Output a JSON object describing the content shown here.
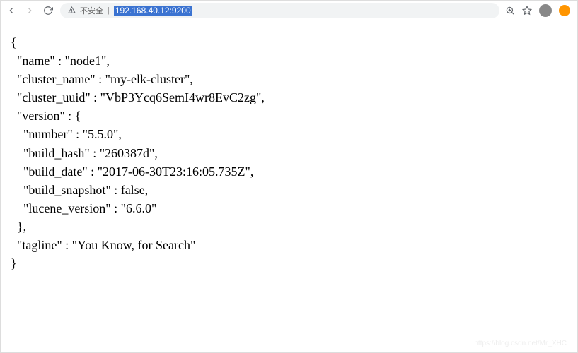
{
  "browser": {
    "insecure_label": "不安全",
    "url": "192.168.40.12:9200"
  },
  "json_response": {
    "name": "node1",
    "cluster_name": "my-elk-cluster",
    "cluster_uuid": "VbP3Ycq6SemI4wr8EvC2zg",
    "version": {
      "number": "5.5.0",
      "build_hash": "260387d",
      "build_date": "2017-06-30T23:16:05.735Z",
      "build_snapshot": false,
      "lucene_version": "6.6.0"
    },
    "tagline": "You Know, for Search"
  },
  "watermark": "https://blog.csdn.net/Mr_XHC"
}
